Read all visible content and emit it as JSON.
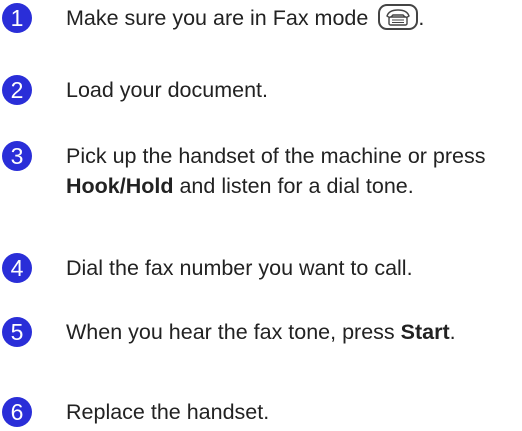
{
  "steps": [
    {
      "number": "1",
      "text_before": "Make sure you are in Fax mode ",
      "icon": "fax-mode-key-icon",
      "text_after": "."
    },
    {
      "number": "2",
      "text": "Load your document."
    },
    {
      "number": "3",
      "text_before": "Pick up the handset of the machine or press ",
      "bold": "Hook/Hold",
      "text_after": " and listen for a dial tone."
    },
    {
      "number": "4",
      "text": "Dial the fax number you want to call."
    },
    {
      "number": "5",
      "text_before": "When you hear the fax tone, press ",
      "bold": "Start",
      "text_after": "."
    },
    {
      "number": "6",
      "text": "Replace the handset."
    }
  ],
  "colors": {
    "badge": "#2a2ed8",
    "text": "#222222"
  }
}
